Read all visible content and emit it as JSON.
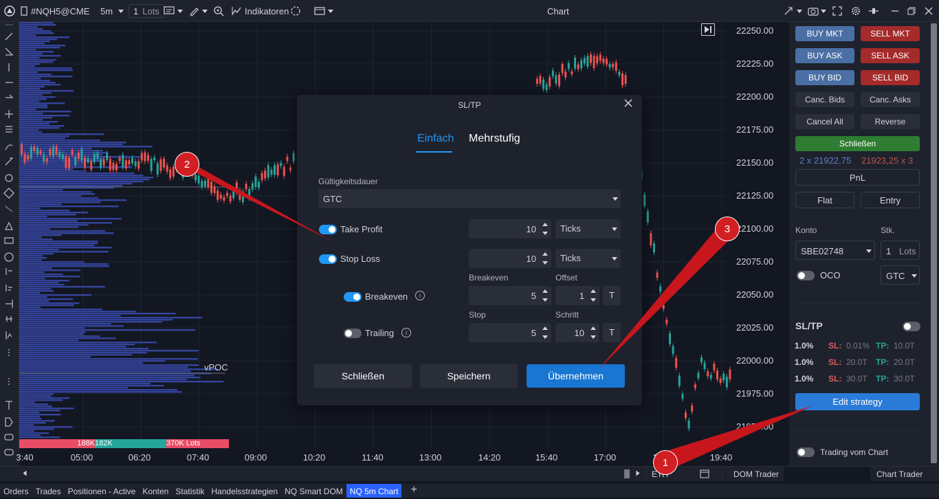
{
  "toolbar": {
    "symbol": "#NQH5@CME",
    "timeframe": "5m",
    "lots": "1",
    "lots_unit": "Lots",
    "indicators_label": "Indikatoren",
    "window_title": "Chart"
  },
  "y_axis": {
    "labels": [
      "22250.00",
      "22225.00",
      "22200.00",
      "22175.00",
      "22150.00",
      "22125.00",
      "22100.00",
      "22075.00",
      "22050.00",
      "22025.00",
      "22000.00",
      "21975.00",
      "21950.00"
    ]
  },
  "x_axis": {
    "labels": [
      "3:40",
      "05:00",
      "06:20",
      "07:40",
      "09:00",
      "10:20",
      "11:40",
      "13:00",
      "14:20",
      "15:40",
      "17:00",
      "1",
      "19:40"
    ]
  },
  "volume_profile": {
    "vpoc_label": "vPOC",
    "stat_1": "188K",
    "stat_2": "182K",
    "stat_3": "370K Lots"
  },
  "dialog": {
    "title": "SL/TP",
    "tabs": [
      {
        "label": "Einfach",
        "active": true
      },
      {
        "label": "Mehrstufig",
        "active": false
      }
    ],
    "validity_label": "Gültigkeitsdauer",
    "validity_value": "GTC",
    "take_profit": {
      "label": "Take Profit",
      "enabled": true,
      "value": "10",
      "unit": "Ticks"
    },
    "stop_loss": {
      "label": "Stop Loss",
      "enabled": true,
      "value": "10",
      "unit": "Ticks"
    },
    "breakeven": {
      "label": "Breakeven",
      "enabled": true,
      "col1_label": "Breakeven",
      "col2_label": "Offset",
      "value": "5",
      "offset": "1",
      "t_button": "T"
    },
    "trailing": {
      "label": "Trailing",
      "enabled": false,
      "col1_label": "Stop",
      "col2_label": "Schritt",
      "value": "5",
      "step": "10",
      "t_button": "T"
    },
    "buttons": {
      "close": "Schließen",
      "save": "Speichern",
      "apply": "Übernehmen"
    }
  },
  "chart_trader": {
    "buy_mkt": "BUY MKT",
    "sell_mkt": "SELL MKT",
    "buy_ask": "BUY ASK",
    "sell_ask": "SELL ASK",
    "buy_bid": "BUY BID",
    "sell_bid": "SELL BID",
    "canc_bids": "Canc. Bids",
    "canc_asks": "Canc. Asks",
    "cancel_all": "Cancel All",
    "reverse": "Reverse",
    "schliessen": "Schließen",
    "bid_info": "2 x 21922,75",
    "ask_info": "21923,25 x 3",
    "pnl": "PnL",
    "flat": "Flat",
    "entry": "Entry",
    "konto_label": "Konto",
    "stk_label": "Stk.",
    "konto_value": "SBE02748",
    "stk_value": "1",
    "stk_unit": "Lots",
    "oco_label": "OCO",
    "oco_enabled": false,
    "tif_value": "GTC",
    "sltp_label": "SL/TP",
    "sltp_enabled": false,
    "sltp_rows": [
      {
        "pct": "1.0%",
        "sl_label": "SL:",
        "sl_value": "0.01%",
        "tp_label": "TP:",
        "tp_value": "10.0T"
      },
      {
        "pct": "1.0%",
        "sl_label": "SL:",
        "sl_value": "20.0T",
        "tp_label": "TP:",
        "tp_value": "20.0T"
      },
      {
        "pct": "1.0%",
        "sl_label": "SL:",
        "sl_value": "30.0T",
        "tp_label": "TP:",
        "tp_value": "30.0T"
      }
    ],
    "edit_strategy": "Edit strategy",
    "trading_vom_chart": "Trading vom Chart",
    "trading_vom_chart_enabled": false
  },
  "bottom_controls": {
    "eth_label": "ETH",
    "dom_trader": "DOM Trader",
    "chart_trader": "Chart Trader"
  },
  "bottom_tabs": [
    {
      "label": "Orders",
      "active": false
    },
    {
      "label": "Trades",
      "active": false
    },
    {
      "label": "Positionen - Active",
      "active": false
    },
    {
      "label": "Konten",
      "active": false
    },
    {
      "label": "Statistik",
      "active": false
    },
    {
      "label": "Handelsstrategien",
      "active": false
    },
    {
      "label": "NQ Smart DOM",
      "active": false
    },
    {
      "label": "NQ 5m Chart",
      "active": true
    }
  ],
  "annotations": [
    "1",
    "2",
    "3"
  ],
  "colors": {
    "up_candle": "#26a69a",
    "down_candle": "#ef5350",
    "profile_blue": "#3949ab",
    "accent_blue": "#2196f3"
  }
}
